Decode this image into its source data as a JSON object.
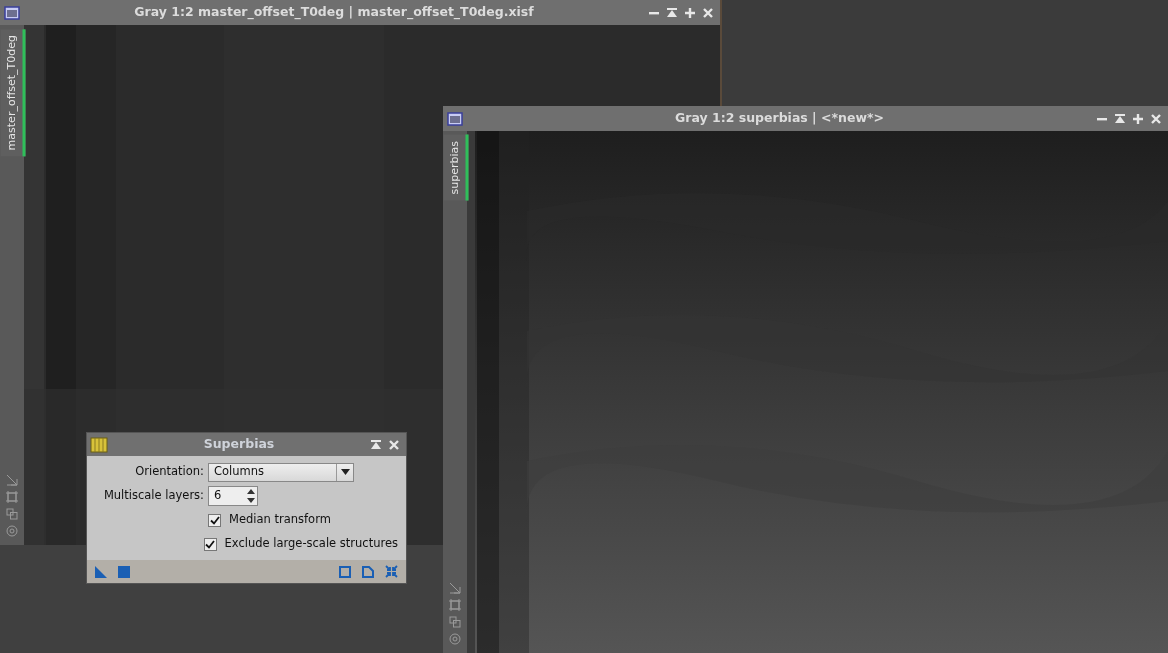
{
  "windows": [
    {
      "title": "Gray 1:2 master_offset_T0deg | master_offset_T0deg.xisf",
      "tab": {
        "label": "master_offset_T0deg",
        "selected": true
      }
    },
    {
      "title": "Gray 1:2 superbias | <*new*>",
      "tab": {
        "label": "superbias",
        "selected": true
      }
    }
  ],
  "dialog": {
    "title": "Superbias",
    "fields": [
      {
        "kind": "select",
        "label": "Orientation:",
        "value": "Columns"
      },
      {
        "kind": "spin",
        "label": "Multiscale layers:",
        "value": "6"
      },
      {
        "kind": "checkbox",
        "label": "Median transform",
        "checked": true
      },
      {
        "kind": "checkbox",
        "label": "Exclude large-scale structures",
        "checked": true
      }
    ]
  }
}
